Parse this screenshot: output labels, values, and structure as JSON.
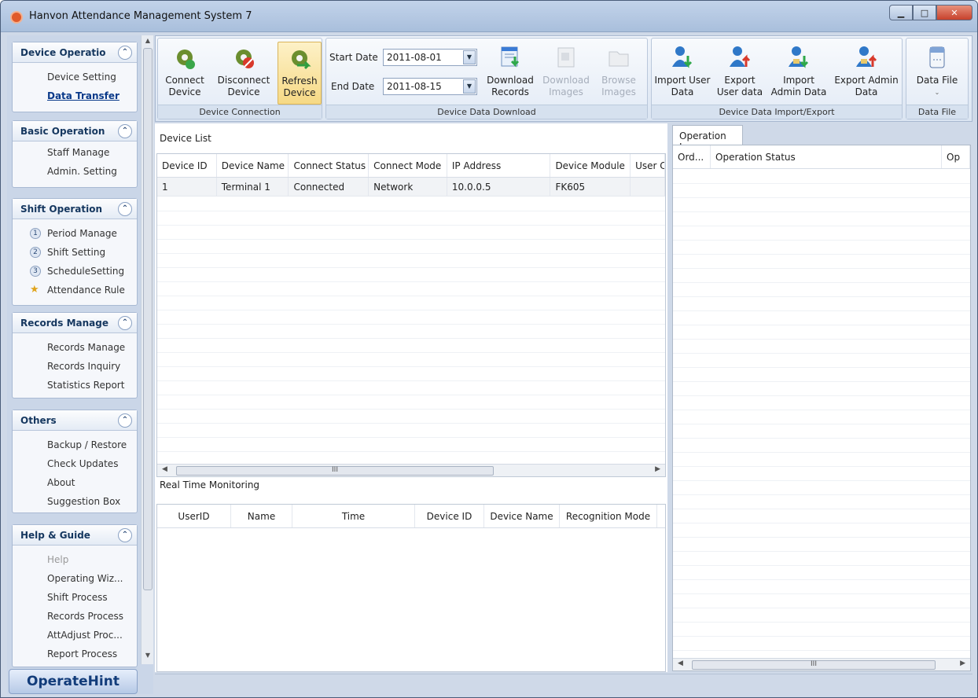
{
  "window": {
    "title": "Hanvon Attendance Management System 7"
  },
  "sidebar": {
    "groups": [
      {
        "title": "Device Operatio",
        "items": [
          "Device Setting",
          "Data Transfer"
        ]
      },
      {
        "title": "Basic Operation",
        "items": [
          "Staff Manage",
          "Admin. Setting"
        ]
      },
      {
        "title": "Shift Operation",
        "items": [
          "Period Manage",
          "Shift Setting",
          "ScheduleSetting",
          "Attendance Rule"
        ]
      },
      {
        "title": "Records Manage",
        "items": [
          "Records Manage",
          "Records Inquiry",
          "Statistics Report"
        ]
      },
      {
        "title": "Others",
        "items": [
          "Backup / Restore",
          "Check Updates",
          "About",
          "Suggestion Box"
        ]
      },
      {
        "title": "Help & Guide",
        "items": [
          "Help",
          "Operating Wiz...",
          "Shift Process",
          "Records Process",
          "AttAdjust Proc...",
          "Report Process"
        ]
      }
    ],
    "shift_numbers": [
      "1",
      "2",
      "3"
    ],
    "hint": "OperateHint"
  },
  "ribbon": {
    "connection": {
      "label": "Device Connection",
      "connect": "Connect Device",
      "disconnect": "Disconnect Device",
      "refresh": "Refresh Device"
    },
    "download": {
      "label": "Device Data Download",
      "start_label": "Start Date",
      "start_value": "2011-08-01",
      "end_label": "End Date",
      "end_value": "2011-08-15",
      "records": "Download Records",
      "images": "Download Images",
      "browse": "Browse Images"
    },
    "import_export": {
      "label": "Device Data Import/Export",
      "import_user": "Import User Data",
      "export_user": "Export User data",
      "import_admin": "Import Admin Data",
      "export_admin": "Export Admin Data"
    },
    "datafile": {
      "label": "Data File",
      "button": "Data File"
    }
  },
  "device_list": {
    "title": "Device List",
    "columns": [
      "Device ID",
      "Device Name",
      "Connect Status",
      "Connect Mode",
      "IP Address",
      "Device Module",
      "User C"
    ],
    "rows": [
      [
        "1",
        "Terminal 1",
        "Connected",
        "Network",
        "10.0.0.5",
        "FK605",
        ""
      ]
    ]
  },
  "realtime": {
    "title": "Real Time Monitoring",
    "columns": [
      "UserID",
      "Name",
      "Time",
      "Device ID",
      "Device Name",
      "Recognition Mode"
    ]
  },
  "oplog": {
    "tab": "Operation Log",
    "columns": [
      "Ord...",
      "Operation Status",
      "Op"
    ]
  },
  "scroll_glyph": "III"
}
